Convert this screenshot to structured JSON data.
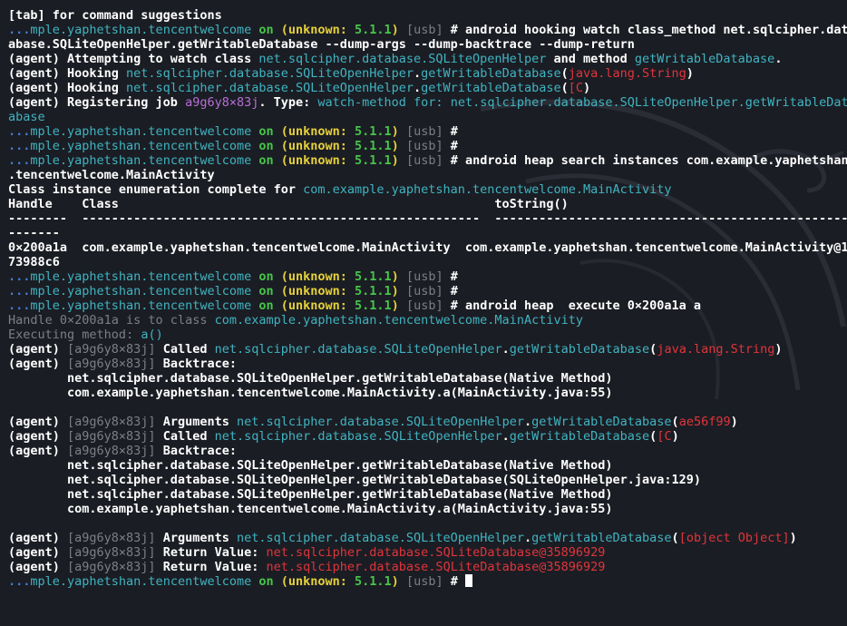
{
  "colors": {
    "background": "#1b1d24",
    "default_text": "#ffffff",
    "teal": "#3fb4c1",
    "blue": "#3e7fd6",
    "green": "#47c64a",
    "yellow": "#e6d23a",
    "gray": "#7b7f87",
    "red": "#e0353b",
    "purple": "#b86fd6"
  },
  "background_icon": "kali-dragon-watermark",
  "lines": [
    [
      {
        "t": "[tab] for command suggestions",
        "c": "white"
      }
    ],
    [
      {
        "t": "...",
        "c": "blue"
      },
      {
        "t": "mple.yaphetshan.tencentwelcome",
        "c": "teal"
      },
      {
        "t": " on ",
        "c": "green"
      },
      {
        "t": "(unknown: ",
        "c": "yellow"
      },
      {
        "t": "5.1.1",
        "c": "green"
      },
      {
        "t": ") ",
        "c": "yellow"
      },
      {
        "t": "[usb]",
        "c": "gray"
      },
      {
        "t": " # android hooking watch class_method net.sqlcipher.dat",
        "c": "white"
      }
    ],
    [
      {
        "t": "abase.SQLiteOpenHelper.getWritableDatabase --dump-args --dump-backtrace --dump-return",
        "c": "white"
      }
    ],
    [
      {
        "t": "(agent) Attempting to watch class ",
        "c": "white"
      },
      {
        "t": "net.sqlcipher.database.SQLiteOpenHelper",
        "c": "teal"
      },
      {
        "t": " and method ",
        "c": "white"
      },
      {
        "t": "getWritableDatabase",
        "c": "teal"
      },
      {
        "t": ".",
        "c": "white"
      }
    ],
    [
      {
        "t": "(agent) Hooking ",
        "c": "white"
      },
      {
        "t": "net.sqlcipher.database.SQLiteOpenHelper",
        "c": "teal"
      },
      {
        "t": ".",
        "c": "white"
      },
      {
        "t": "getWritableDatabase",
        "c": "teal"
      },
      {
        "t": "(",
        "c": "white"
      },
      {
        "t": "java.lang.String",
        "c": "red"
      },
      {
        "t": ")",
        "c": "white"
      }
    ],
    [
      {
        "t": "(agent) Hooking ",
        "c": "white"
      },
      {
        "t": "net.sqlcipher.database.SQLiteOpenHelper",
        "c": "teal"
      },
      {
        "t": ".",
        "c": "white"
      },
      {
        "t": "getWritableDatabase",
        "c": "teal"
      },
      {
        "t": "(",
        "c": "white"
      },
      {
        "t": "[C",
        "c": "red"
      },
      {
        "t": ")",
        "c": "white"
      }
    ],
    [
      {
        "t": "(agent) Registering job ",
        "c": "white"
      },
      {
        "t": "a9g6y8×83j",
        "c": "purple"
      },
      {
        "t": ". Type: ",
        "c": "white"
      },
      {
        "t": "watch-method for: net.sqlcipher.database.SQLiteOpenHelper.getWritableDat",
        "c": "teal"
      }
    ],
    [
      {
        "t": "abase",
        "c": "teal"
      }
    ],
    [
      {
        "t": "...",
        "c": "blue"
      },
      {
        "t": "mple.yaphetshan.tencentwelcome",
        "c": "teal"
      },
      {
        "t": " on ",
        "c": "green"
      },
      {
        "t": "(unknown: ",
        "c": "yellow"
      },
      {
        "t": "5.1.1",
        "c": "green"
      },
      {
        "t": ") ",
        "c": "yellow"
      },
      {
        "t": "[usb]",
        "c": "gray"
      },
      {
        "t": " #",
        "c": "white"
      }
    ],
    [
      {
        "t": "...",
        "c": "blue"
      },
      {
        "t": "mple.yaphetshan.tencentwelcome",
        "c": "teal"
      },
      {
        "t": " on ",
        "c": "green"
      },
      {
        "t": "(unknown: ",
        "c": "yellow"
      },
      {
        "t": "5.1.1",
        "c": "green"
      },
      {
        "t": ") ",
        "c": "yellow"
      },
      {
        "t": "[usb]",
        "c": "gray"
      },
      {
        "t": " #",
        "c": "white"
      }
    ],
    [
      {
        "t": "...",
        "c": "blue"
      },
      {
        "t": "mple.yaphetshan.tencentwelcome",
        "c": "teal"
      },
      {
        "t": " on ",
        "c": "green"
      },
      {
        "t": "(unknown: ",
        "c": "yellow"
      },
      {
        "t": "5.1.1",
        "c": "green"
      },
      {
        "t": ") ",
        "c": "yellow"
      },
      {
        "t": "[usb]",
        "c": "gray"
      },
      {
        "t": " # android heap search instances com.example.yaphetshan",
        "c": "white"
      }
    ],
    [
      {
        "t": ".tencentwelcome.MainActivity",
        "c": "white"
      }
    ],
    [
      {
        "t": "Class instance enumeration complete for ",
        "c": "white"
      },
      {
        "t": "com.example.yaphetshan.tencentwelcome.MainActivity",
        "c": "teal"
      }
    ],
    [
      {
        "t": "Handle    Class                                                   toString()",
        "c": "white"
      }
    ],
    [
      {
        "t": "--------  ------------------------------------------------------  ------------------------------------------------------",
        "c": "white"
      }
    ],
    [
      {
        "t": "-------",
        "c": "white"
      }
    ],
    [
      {
        "t": "0×200a1a  com.example.yaphetshan.tencentwelcome.MainActivity  com.example.yaphetshan.tencentwelcome.MainActivity@1",
        "c": "white"
      }
    ],
    [
      {
        "t": "73988c6",
        "c": "white"
      }
    ],
    [
      {
        "t": "...",
        "c": "blue"
      },
      {
        "t": "mple.yaphetshan.tencentwelcome",
        "c": "teal"
      },
      {
        "t": " on ",
        "c": "green"
      },
      {
        "t": "(unknown: ",
        "c": "yellow"
      },
      {
        "t": "5.1.1",
        "c": "green"
      },
      {
        "t": ") ",
        "c": "yellow"
      },
      {
        "t": "[usb]",
        "c": "gray"
      },
      {
        "t": " #",
        "c": "white"
      }
    ],
    [
      {
        "t": "...",
        "c": "blue"
      },
      {
        "t": "mple.yaphetshan.tencentwelcome",
        "c": "teal"
      },
      {
        "t": " on ",
        "c": "green"
      },
      {
        "t": "(unknown: ",
        "c": "yellow"
      },
      {
        "t": "5.1.1",
        "c": "green"
      },
      {
        "t": ") ",
        "c": "yellow"
      },
      {
        "t": "[usb]",
        "c": "gray"
      },
      {
        "t": " #",
        "c": "white"
      }
    ],
    [
      {
        "t": "...",
        "c": "blue"
      },
      {
        "t": "mple.yaphetshan.tencentwelcome",
        "c": "teal"
      },
      {
        "t": " on ",
        "c": "green"
      },
      {
        "t": "(unknown: ",
        "c": "yellow"
      },
      {
        "t": "5.1.1",
        "c": "green"
      },
      {
        "t": ") ",
        "c": "yellow"
      },
      {
        "t": "[usb]",
        "c": "gray"
      },
      {
        "t": " # android heap  execute 0×200a1a a",
        "c": "white"
      }
    ],
    [
      {
        "t": "Handle 0×200a1a is to class ",
        "c": "gray"
      },
      {
        "t": "com.example.yaphetshan.tencentwelcome.MainActivity",
        "c": "teal"
      }
    ],
    [
      {
        "t": "Executing method: ",
        "c": "gray"
      },
      {
        "t": "a()",
        "c": "teal"
      }
    ],
    [
      {
        "t": "(agent) ",
        "c": "white"
      },
      {
        "t": "[a9g6y8×83j]",
        "c": "gray"
      },
      {
        "t": " Called ",
        "c": "white"
      },
      {
        "t": "net.sqlcipher.database.SQLiteOpenHelper",
        "c": "teal"
      },
      {
        "t": ".",
        "c": "white"
      },
      {
        "t": "getWritableDatabase",
        "c": "teal"
      },
      {
        "t": "(",
        "c": "white"
      },
      {
        "t": "java.lang.String",
        "c": "red"
      },
      {
        "t": ")",
        "c": "white"
      }
    ],
    [
      {
        "t": "(agent) ",
        "c": "white"
      },
      {
        "t": "[a9g6y8×83j]",
        "c": "gray"
      },
      {
        "t": " Backtrace:",
        "c": "white"
      }
    ],
    [
      {
        "t": "        net.sqlcipher.database.SQLiteOpenHelper.getWritableDatabase(Native Method)",
        "c": "white"
      }
    ],
    [
      {
        "t": "        com.example.yaphetshan.tencentwelcome.MainActivity.a(MainActivity.java:55)",
        "c": "white"
      }
    ],
    [
      {
        "t": "",
        "c": "white"
      }
    ],
    [
      {
        "t": "(agent) ",
        "c": "white"
      },
      {
        "t": "[a9g6y8×83j]",
        "c": "gray"
      },
      {
        "t": " Arguments ",
        "c": "white"
      },
      {
        "t": "net.sqlcipher.database.SQLiteOpenHelper",
        "c": "teal"
      },
      {
        "t": ".",
        "c": "white"
      },
      {
        "t": "getWritableDatabase",
        "c": "teal"
      },
      {
        "t": "(",
        "c": "white"
      },
      {
        "t": "ae56f99",
        "c": "red"
      },
      {
        "t": ")",
        "c": "white"
      }
    ],
    [
      {
        "t": "(agent) ",
        "c": "white"
      },
      {
        "t": "[a9g6y8×83j]",
        "c": "gray"
      },
      {
        "t": " Called ",
        "c": "white"
      },
      {
        "t": "net.sqlcipher.database.SQLiteOpenHelper",
        "c": "teal"
      },
      {
        "t": ".",
        "c": "white"
      },
      {
        "t": "getWritableDatabase",
        "c": "teal"
      },
      {
        "t": "(",
        "c": "white"
      },
      {
        "t": "[C",
        "c": "red"
      },
      {
        "t": ")",
        "c": "white"
      }
    ],
    [
      {
        "t": "(agent) ",
        "c": "white"
      },
      {
        "t": "[a9g6y8×83j]",
        "c": "gray"
      },
      {
        "t": " Backtrace:",
        "c": "white"
      }
    ],
    [
      {
        "t": "        net.sqlcipher.database.SQLiteOpenHelper.getWritableDatabase(Native Method)",
        "c": "white"
      }
    ],
    [
      {
        "t": "        net.sqlcipher.database.SQLiteOpenHelper.getWritableDatabase(SQLiteOpenHelper.java:129)",
        "c": "white"
      }
    ],
    [
      {
        "t": "        net.sqlcipher.database.SQLiteOpenHelper.getWritableDatabase(Native Method)",
        "c": "white"
      }
    ],
    [
      {
        "t": "        com.example.yaphetshan.tencentwelcome.MainActivity.a(MainActivity.java:55)",
        "c": "white"
      }
    ],
    [
      {
        "t": "",
        "c": "white"
      }
    ],
    [
      {
        "t": "(agent) ",
        "c": "white"
      },
      {
        "t": "[a9g6y8×83j]",
        "c": "gray"
      },
      {
        "t": " Arguments ",
        "c": "white"
      },
      {
        "t": "net.sqlcipher.database.SQLiteOpenHelper",
        "c": "teal"
      },
      {
        "t": ".",
        "c": "white"
      },
      {
        "t": "getWritableDatabase",
        "c": "teal"
      },
      {
        "t": "(",
        "c": "white"
      },
      {
        "t": "[object Object]",
        "c": "red"
      },
      {
        "t": ")",
        "c": "white"
      }
    ],
    [
      {
        "t": "(agent) ",
        "c": "white"
      },
      {
        "t": "[a9g6y8×83j]",
        "c": "gray"
      },
      {
        "t": " Return Value: ",
        "c": "white"
      },
      {
        "t": "net.sqlcipher.database.SQLiteDatabase@35896929",
        "c": "red"
      }
    ],
    [
      {
        "t": "(agent) ",
        "c": "white"
      },
      {
        "t": "[a9g6y8×83j]",
        "c": "gray"
      },
      {
        "t": " Return Value: ",
        "c": "white"
      },
      {
        "t": "net.sqlcipher.database.SQLiteDatabase@35896929",
        "c": "red"
      }
    ],
    [
      {
        "t": "...",
        "c": "blue"
      },
      {
        "t": "mple.yaphetshan.tencentwelcome",
        "c": "teal"
      },
      {
        "t": " on ",
        "c": "green"
      },
      {
        "t": "(unknown: ",
        "c": "yellow"
      },
      {
        "t": "5.1.1",
        "c": "green"
      },
      {
        "t": ") ",
        "c": "yellow"
      },
      {
        "t": "[usb]",
        "c": "gray"
      },
      {
        "t": " # ",
        "c": "white"
      }
    ]
  ]
}
